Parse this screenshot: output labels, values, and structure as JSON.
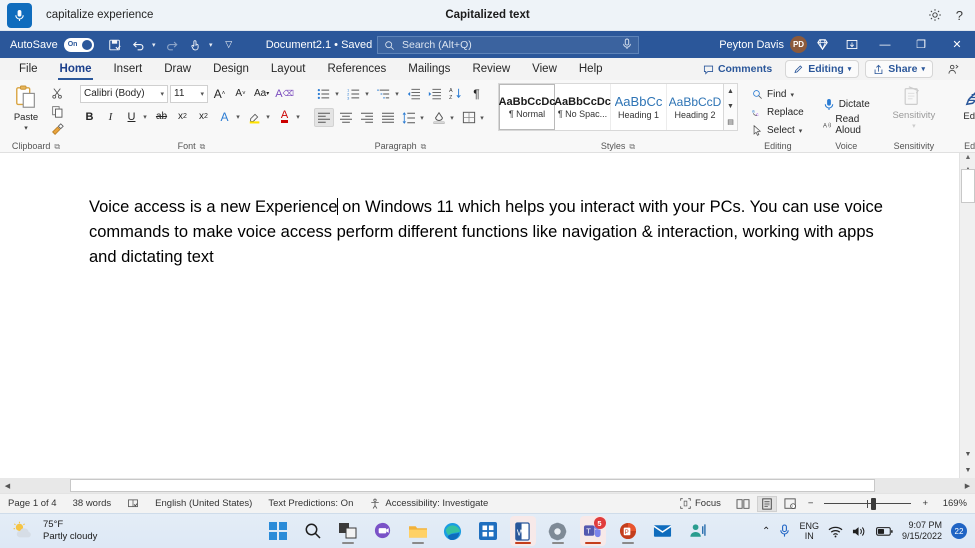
{
  "voice_access": {
    "mic_icon": "microphone-icon",
    "phrase": "capitalize experience",
    "status_title": "Capitalized text",
    "settings_icon": "gear-icon",
    "help_icon": "question-mark-icon"
  },
  "title_bar": {
    "autosave_label": "AutoSave",
    "autosave_state": "On",
    "save_icon": "save-icon",
    "undo_icon": "undo-icon",
    "redo_icon": "redo-icon",
    "touch_icon": "touch-mode-icon",
    "customize_icon": "customize-quick-access-icon",
    "document_name": "Document2.1 • Saved",
    "search": {
      "placeholder": "Search (Alt+Q)",
      "icon": "search-icon",
      "mic_icon": "microphone-icon"
    },
    "user_name": "Peyton Davis",
    "user_initials": "PD",
    "premium_icon": "diamond-icon",
    "ribbon_display_icon": "ribbon-display-options-icon",
    "minimize": "—",
    "restore": "❐",
    "close": "✕"
  },
  "tabs": [
    {
      "label": "File",
      "active": false
    },
    {
      "label": "Home",
      "active": true
    },
    {
      "label": "Insert",
      "active": false
    },
    {
      "label": "Draw",
      "active": false
    },
    {
      "label": "Design",
      "active": false
    },
    {
      "label": "Layout",
      "active": false
    },
    {
      "label": "References",
      "active": false
    },
    {
      "label": "Mailings",
      "active": false
    },
    {
      "label": "Review",
      "active": false
    },
    {
      "label": "View",
      "active": false
    },
    {
      "label": "Help",
      "active": false
    }
  ],
  "tabs_right": {
    "comments": "Comments",
    "editing": "Editing",
    "share": "Share",
    "catch_up_icon": "catch-up-person-icon"
  },
  "ribbon": {
    "clipboard": {
      "group_label": "Clipboard",
      "paste_label": "Paste",
      "cut_icon": "scissors-icon",
      "copy_icon": "copy-icon",
      "format_painter_icon": "format-painter-icon"
    },
    "font": {
      "group_label": "Font",
      "font_name": "Calibri (Body)",
      "font_size": "11",
      "grow_icon": "grow-font-icon",
      "shrink_icon": "shrink-font-icon",
      "change_case_icon": "change-case-icon",
      "clear_formatting_icon": "clear-formatting-icon",
      "bold": "B",
      "italic": "I",
      "underline": "U",
      "strikethrough_icon": "strikethrough-icon",
      "subscript_icon": "subscript-icon",
      "superscript_icon": "superscript-icon",
      "text_effects_icon": "text-effects-icon",
      "highlight_icon": "text-highlight-icon",
      "font_color_icon": "font-color-icon"
    },
    "paragraph": {
      "group_label": "Paragraph",
      "bullets_icon": "bullet-list-icon",
      "numbering_icon": "numbered-list-icon",
      "multilevel_icon": "multilevel-list-icon",
      "decrease_indent_icon": "decrease-indent-icon",
      "increase_indent_icon": "increase-indent-icon",
      "sort_icon": "sort-icon",
      "show_marks_icon": "paragraph-marks-icon",
      "align_left_icon": "align-left-icon",
      "align_center_icon": "align-center-icon",
      "align_right_icon": "align-right-icon",
      "justify_icon": "justify-icon",
      "line_spacing_icon": "line-spacing-icon",
      "shading_icon": "shading-icon",
      "borders_icon": "borders-icon"
    },
    "styles": {
      "group_label": "Styles",
      "items": [
        {
          "preview": "AaBbCcDc",
          "name": "¶ Normal",
          "selected": true
        },
        {
          "preview": "AaBbCcDc",
          "name": "¶ No Spac...",
          "selected": false
        },
        {
          "preview": "AaBbCc",
          "name": "Heading 1",
          "selected": false
        },
        {
          "preview": "AaBbCcD",
          "name": "Heading 2",
          "selected": false
        }
      ]
    },
    "editing": {
      "group_label": "Editing",
      "find": "Find",
      "replace": "Replace",
      "select": "Select"
    },
    "voice": {
      "group_label": "Voice",
      "dictate": "Dictate",
      "read_aloud": "Read Aloud"
    },
    "sensitivity": {
      "group_label": "Sensitivity",
      "label": "Sensitivity"
    },
    "editor": {
      "group_label": "Editor",
      "label": "Editor"
    },
    "collapse_icon": "collapse-ribbon-icon"
  },
  "document": {
    "paragraph_before_cursor": "Voice access is a new Experience",
    "paragraph_after_cursor": " on Windows 11 which helps you interact with your PCs. You can use voice commands to make voice access perform different functions like navigation & interaction, working with apps and dictating text"
  },
  "status_bar": {
    "page": "Page 1 of 4",
    "words": "38 words",
    "proofing_icon": "proofing-errors-icon",
    "language": "English (United States)",
    "text_predictions": "Text Predictions: On",
    "accessibility_icon": "accessibility-icon",
    "accessibility": "Accessibility: Investigate",
    "focus": "Focus",
    "read_mode_icon": "read-mode-icon",
    "print_layout_icon": "print-layout-icon",
    "web_layout_icon": "web-layout-icon",
    "zoom_out": "−",
    "zoom_in": "+",
    "zoom_level": "169%"
  },
  "taskbar": {
    "weather_temp": "75°F",
    "weather_desc": "Partly cloudy",
    "weather_icon": "partly-cloudy-icon",
    "icons": [
      {
        "name": "start-button",
        "label": "Start"
      },
      {
        "name": "search-taskbar-icon",
        "label": "Search"
      },
      {
        "name": "task-view-icon",
        "label": "Task View"
      },
      {
        "name": "chat-icon",
        "label": "Chat"
      },
      {
        "name": "file-explorer-icon",
        "label": "File Explorer"
      },
      {
        "name": "edge-icon",
        "label": "Microsoft Edge"
      },
      {
        "name": "microsoft-store-icon",
        "label": "Microsoft Store"
      },
      {
        "name": "word-icon",
        "label": "Word"
      },
      {
        "name": "settings-icon",
        "label": "Settings"
      },
      {
        "name": "teams-icon",
        "label": "Microsoft Teams"
      },
      {
        "name": "powerpoint-icon",
        "label": "PowerPoint"
      },
      {
        "name": "mail-icon",
        "label": "Mail"
      },
      {
        "name": "voice-access-icon",
        "label": "Voice Access"
      }
    ],
    "teams_badge": "5",
    "tray": {
      "chevron_icon": "show-hidden-icons-icon",
      "mic_icon": "microphone-icon",
      "language_line1": "ENG",
      "language_line2": "IN",
      "wifi_icon": "wifi-icon",
      "volume_icon": "volume-icon",
      "battery_icon": "battery-icon",
      "time": "9:07 PM",
      "date": "9/15/2022",
      "notification_count": "22"
    }
  },
  "colors": {
    "word_blue": "#2b579a",
    "accent": "#1b3f8b",
    "voice_bar": "#eef3f8"
  }
}
